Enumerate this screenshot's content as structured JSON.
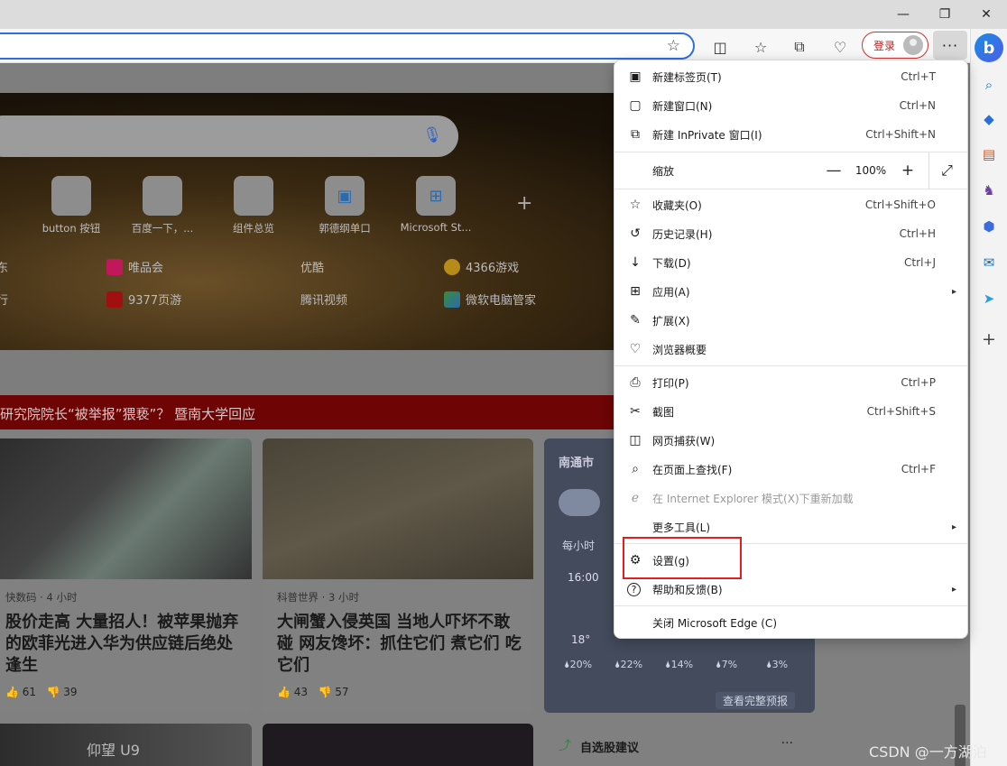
{
  "window": {
    "minimize_glyph": "—",
    "restore_glyph": "❐",
    "close_glyph": "✕"
  },
  "toolbar": {
    "favorite_glyph": "☆",
    "login_label": "登录",
    "more_glyph": "···"
  },
  "page": {
    "tiles": [
      {
        "label": "button 按钮"
      },
      {
        "label": "百度一下，..."
      },
      {
        "label": "组件总览"
      },
      {
        "label": "郭德纲单口"
      },
      {
        "label": "Microsoft St..."
      }
    ],
    "quick_links_row1": [
      "唯品会",
      "优酷",
      "4366游戏"
    ],
    "quick_links_row2": [
      "9377页游",
      "腾讯视频",
      "微软电脑管家"
    ],
    "partial_left_1": "东",
    "partial_left_2": "行",
    "banner_text": "研究院院长“被举报”猥亵”？ 暨南大学回应",
    "cards": [
      {
        "source": "快数码 · 4 小时",
        "title": "股价走高 大量招人！被苹果抛弃的欧菲光进入华为供应链后绝处逢生",
        "likes": "61",
        "dislikes": "39"
      },
      {
        "source": "科普世界 · 3 小时",
        "title": "大闸蟹入侵英国 当地人吓坏不敢碰 网友馋坏：抓住它们 煮它们 吃它们",
        "likes": "43",
        "dislikes": "57"
      }
    ],
    "weather": {
      "city": "南通市",
      "tab": "每小时",
      "time": "16:00",
      "temp": "18°",
      "precip": [
        "20%",
        "22%",
        "14%",
        "7%",
        "3%"
      ],
      "more": "查看完整预报"
    },
    "stock_card_title": "自选股建议",
    "bottom_image_text": "仰望 U9"
  },
  "menu": {
    "items": [
      {
        "label": "新建标签页(T)",
        "shortcut": "Ctrl+T",
        "icon": "new-tab-icon",
        "glyph": "▣"
      },
      {
        "label": "新建窗口(N)",
        "shortcut": "Ctrl+N",
        "icon": "new-window-icon",
        "glyph": "▢"
      },
      {
        "label": "新建 InPrivate 窗口(I)",
        "shortcut": "Ctrl+Shift+N",
        "icon": "inprivate-icon",
        "glyph": "⧉"
      },
      {
        "label": "缩放",
        "icon": "zoom-icon",
        "glyph": ""
      },
      {
        "label": "收藏夹(O)",
        "shortcut": "Ctrl+Shift+O",
        "icon": "favorites-icon",
        "glyph": "☆"
      },
      {
        "label": "历史记录(H)",
        "shortcut": "Ctrl+H",
        "icon": "history-icon",
        "glyph": "↺"
      },
      {
        "label": "下载(D)",
        "shortcut": "Ctrl+J",
        "icon": "download-icon",
        "glyph": "↓"
      },
      {
        "label": "应用(A)",
        "icon": "apps-icon",
        "glyph": "⊞"
      },
      {
        "label": "扩展(X)",
        "icon": "extensions-icon",
        "glyph": "✎"
      },
      {
        "label": "浏览器概要",
        "icon": "browser-essentials-icon",
        "glyph": "♡"
      },
      {
        "label": "打印(P)",
        "shortcut": "Ctrl+P",
        "icon": "print-icon",
        "glyph": "⎙"
      },
      {
        "label": "截图",
        "shortcut": "Ctrl+Shift+S",
        "icon": "screenshot-icon",
        "glyph": "✂"
      },
      {
        "label": "网页捕获(W)",
        "icon": "web-capture-icon",
        "glyph": "◫"
      },
      {
        "label": "在页面上查找(F)",
        "shortcut": "Ctrl+F",
        "icon": "find-icon",
        "glyph": "⌕"
      },
      {
        "label": "在 Internet Explorer 模式(X)下重新加载",
        "icon": "ie-mode-icon",
        "glyph": "ℯ"
      },
      {
        "label": "更多工具(L)",
        "icon": "",
        "glyph": ""
      },
      {
        "label": "设置(g)",
        "icon": "settings-icon",
        "glyph": "⚙"
      },
      {
        "label": "帮助和反馈(B)",
        "icon": "help-icon",
        "glyph": "?"
      },
      {
        "label": "关闭 Microsoft Edge (C)",
        "icon": "",
        "glyph": ""
      }
    ],
    "zoom": {
      "value": "100%",
      "minus": "—",
      "plus": "+",
      "fullscreen_glyph": "⤢"
    },
    "submenu_arrow": "▸"
  },
  "watermark": "CSDN @一方湖泊",
  "colors": {
    "highlight_box": "#e02020",
    "login_border": "#cc3333",
    "address_border": "#2f6fdb",
    "banner": "#6e0404"
  }
}
